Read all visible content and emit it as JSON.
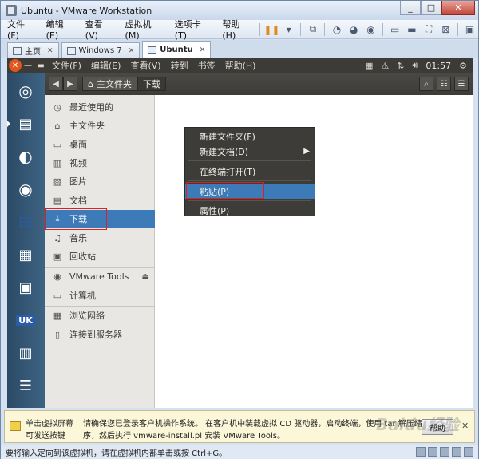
{
  "window": {
    "title": "Ubuntu - VMware Workstation"
  },
  "menubar": {
    "items": [
      "文件(F)",
      "编辑(E)",
      "查看(V)",
      "虚拟机(M)",
      "选项卡(T)",
      "帮助(H)"
    ]
  },
  "tabs": [
    {
      "label": "主页",
      "active": false
    },
    {
      "label": "Windows 7",
      "active": false
    },
    {
      "label": "Ubuntu",
      "active": true
    }
  ],
  "ubuntu_top": {
    "menus": [
      "文件(F)",
      "编辑(E)",
      "查看(V)",
      "转到",
      "书签",
      "帮助(H)"
    ],
    "clock": "01:57"
  },
  "launcher": {
    "apps": [
      {
        "name": "dash",
        "icon": "ubuntu-logo-icon",
        "color": "#2f5f87"
      },
      {
        "name": "files",
        "icon": "file-cabinet-icon",
        "color": "#7a5a44"
      },
      {
        "name": "firefox",
        "icon": "firefox-icon",
        "color": "#d8691c"
      },
      {
        "name": "chromium",
        "icon": "chromium-icon",
        "color": "#6c8cbc"
      },
      {
        "name": "writer",
        "icon": "document-icon",
        "color": "#e9eef5"
      },
      {
        "name": "calc",
        "icon": "spreadsheet-icon",
        "color": "#3c9d3c"
      },
      {
        "name": "impress",
        "icon": "presentation-icon",
        "color": "#d9773a"
      },
      {
        "name": "ubuntu-one",
        "icon": "ubuntu-one-icon",
        "color": "#dfe6ef",
        "label": "UK"
      },
      {
        "name": "workspaces",
        "icon": "workspace-switcher-icon",
        "color": "#4a6e8e"
      }
    ]
  },
  "breadcrumb": {
    "home": "主文件夹",
    "current": "下载"
  },
  "sidebar": {
    "places": [
      {
        "label": "最近使用的",
        "icon": "clock-icon"
      },
      {
        "label": "主文件夹",
        "icon": "home-icon"
      },
      {
        "label": "桌面",
        "icon": "desktop-icon"
      },
      {
        "label": "视频",
        "icon": "video-icon"
      },
      {
        "label": "图片",
        "icon": "picture-icon"
      },
      {
        "label": "文档",
        "icon": "document-icon"
      },
      {
        "label": "下载",
        "icon": "download-icon",
        "selected": true
      },
      {
        "label": "音乐",
        "icon": "music-icon"
      },
      {
        "label": "回收站",
        "icon": "trash-icon"
      }
    ],
    "devices": [
      {
        "label": "VMware Tools",
        "icon": "disc-icon"
      },
      {
        "label": "计算机",
        "icon": "computer-icon"
      }
    ],
    "network": [
      {
        "label": "浏览网络",
        "icon": "network-icon"
      },
      {
        "label": "连接到服务器",
        "icon": "server-icon"
      }
    ]
  },
  "context_menu": {
    "items": [
      "新建文件夹(F)",
      "新建文档(D)",
      "在终端打开(T)",
      "粘贴(P)",
      "属性(P)"
    ]
  },
  "infobar": {
    "left1": "单击虚拟屏幕",
    "left2": "可发送按键",
    "line1": "请确保您已登录客户机操作系统。 在客户机中装载虚拟 CD 驱动器，启动终端，使用 tar 解压缩安装程",
    "line2": "序，然后执行 vmware-install.pl 安装 VMware Tools。",
    "button": "帮助"
  },
  "status": {
    "text": "要将输入定向到该虚拟机，请在虚拟机内部单击或按 Ctrl+G。"
  },
  "watermark": "Baidu经验"
}
